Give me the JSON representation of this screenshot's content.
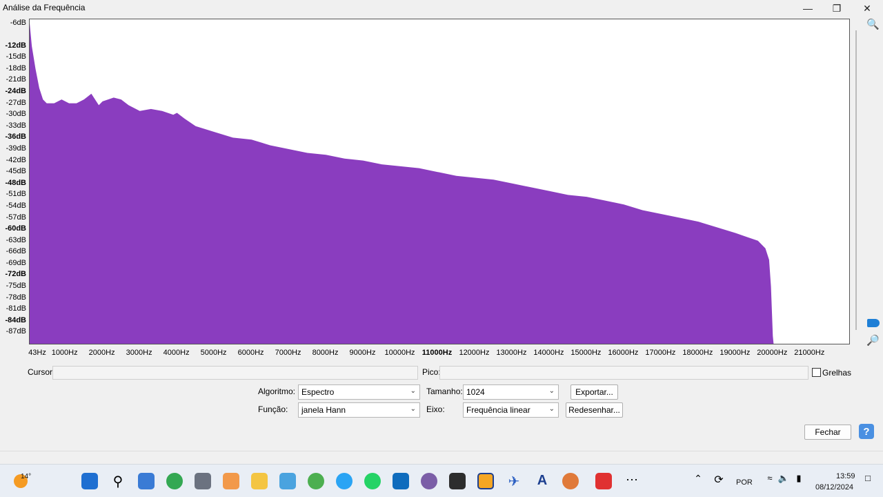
{
  "window": {
    "title": "Análise da Frequência"
  },
  "chart_data": {
    "type": "area",
    "y_ticks": [
      "-6dB",
      "-12dB",
      "-15dB",
      "-18dB",
      "-21dB",
      "-24dB",
      "-27dB",
      "-30dB",
      "-33dB",
      "-36dB",
      "-39dB",
      "-42dB",
      "-45dB",
      "-48dB",
      "-51dB",
      "-54dB",
      "-57dB",
      "-60dB",
      "-63dB",
      "-66dB",
      "-69dB",
      "-72dB",
      "-75dB",
      "-78dB",
      "-81dB",
      "-84dB",
      "-87dB"
    ],
    "y_bold": [
      "-12dB",
      "-24dB",
      "-36dB",
      "-48dB",
      "-60dB",
      "-72dB",
      "-84dB"
    ],
    "x_ticks": [
      "43Hz",
      "1000Hz",
      "2000Hz",
      "3000Hz",
      "4000Hz",
      "5000Hz",
      "6000Hz",
      "7000Hz",
      "8000Hz",
      "9000Hz",
      "10000Hz",
      "11000Hz",
      "12000Hz",
      "13000Hz",
      "14000Hz",
      "15000Hz",
      "16000Hz",
      "17000Hz",
      "18000Hz",
      "19000Hz",
      "20000Hz",
      "21000Hz"
    ],
    "x_bold": [
      "11000Hz"
    ],
    "xlim": [
      43,
      22050
    ],
    "ylim": [
      -90,
      -5
    ],
    "fill_color": "#8a3dbf",
    "series": [
      {
        "x": [
          43,
          100,
          200,
          300,
          400,
          500,
          700,
          900,
          1000,
          1100,
          1300,
          1500,
          1700,
          1900,
          2000,
          2300,
          2500,
          2700,
          3000,
          3300,
          3600,
          3900,
          4000,
          4200,
          4500,
          5000,
          5500,
          6000,
          6500,
          7000,
          7500,
          8000,
          8500,
          9000,
          9500,
          10000,
          10500,
          11000,
          11500,
          12000,
          12500,
          13000,
          13500,
          14000,
          14500,
          15000,
          15500,
          16000,
          16500,
          17000,
          17500,
          18000,
          18500,
          19000,
          19300,
          19600,
          19800,
          19900,
          19950,
          20000,
          20020
        ],
        "y": [
          -6,
          -12,
          -18,
          -23,
          -26,
          -27,
          -27,
          -26,
          -26.5,
          -27,
          -27,
          -26,
          -24.5,
          -27.5,
          -26.5,
          -25.5,
          -26,
          -27.5,
          -29,
          -28.5,
          -29,
          -30,
          -29.5,
          -31,
          -33,
          -34.5,
          -36,
          -36.5,
          -38,
          -39,
          -40,
          -40.5,
          -41.5,
          -42,
          -43,
          -43.5,
          -44,
          -45,
          -46,
          -46.5,
          -47,
          -48,
          -49,
          -50,
          -51,
          -51.5,
          -52.5,
          -53.5,
          -55,
          -56,
          -57,
          -58,
          -59.5,
          -61,
          -62,
          -63,
          -65,
          -68,
          -75,
          -88,
          -90
        ]
      }
    ]
  },
  "controls": {
    "cursor_label": "Cursor:",
    "cursor_value": "",
    "peak_label": "Pico:",
    "peak_value": "",
    "grid_label": "Grelhas",
    "algorithm_label": "Algoritmo:",
    "algorithm_value": "Espectro",
    "function_label": "Função:",
    "function_value": "janela Hann",
    "size_label": "Tamanho:",
    "size_value": "1024",
    "axis_label": "Eixo:",
    "axis_value": "Frequência linear",
    "export_button": "Exportar...",
    "redraw_button": "Redesenhar...",
    "close_button": "Fechar"
  },
  "taskbar": {
    "weather_temp": "14°",
    "language": "POR",
    "time": "13:59",
    "date": "08/12/2024"
  }
}
